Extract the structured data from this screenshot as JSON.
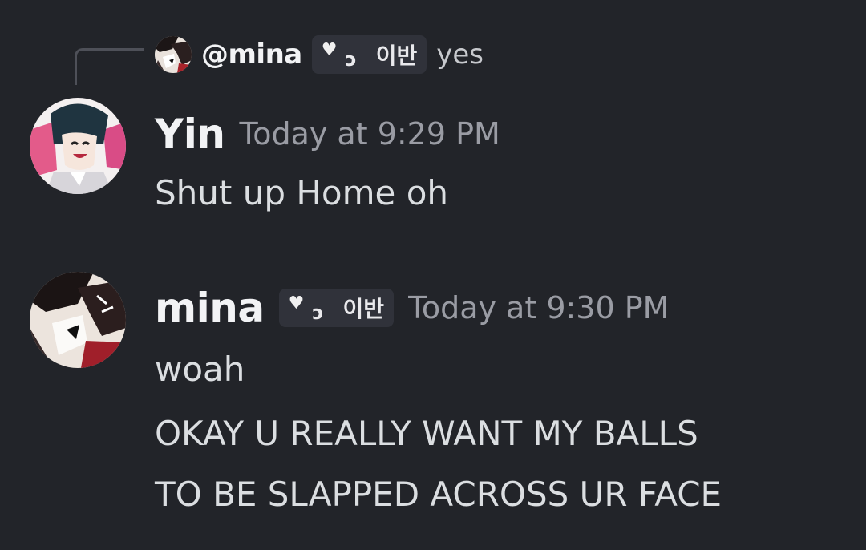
{
  "reply": {
    "name": "@mina",
    "tag_text": "이반",
    "message": "yes"
  },
  "messages": [
    {
      "author": "Yin",
      "timestamp": "Today at 9:29 PM",
      "lines": [
        "Shut up Home oh"
      ]
    },
    {
      "author": "mina",
      "tag_text": "이반",
      "timestamp": "Today at 9:30 PM",
      "lines": [
        "woah",
        "OKAY U REALLY WANT MY BALLS",
        "TO BE SLAPPED ACROSS UR FACE"
      ]
    }
  ],
  "icons": {
    "tag_heart": "heart-icon",
    "tag_hook": "hook-glyph"
  }
}
